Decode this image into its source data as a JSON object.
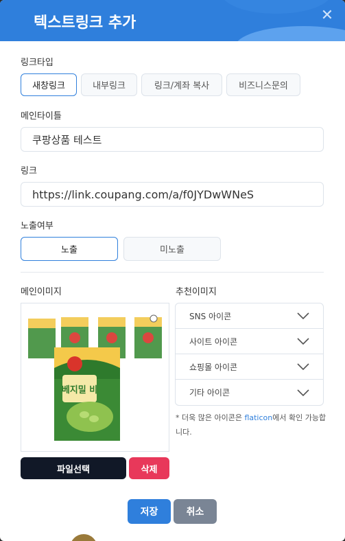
{
  "header": {
    "title": "텍스트링크 추가",
    "close_label": "✕"
  },
  "link_type": {
    "label": "링크타입",
    "tabs": [
      "새창링크",
      "내부링크",
      "링크/계좌 복사",
      "비즈니스문의"
    ],
    "active": "새창링크"
  },
  "main_title": {
    "label": "메인타이틀",
    "value": "쿠팡상품 테스트"
  },
  "link": {
    "label": "링크",
    "value": "https://link.coupang.com/a/f0JYDwWNeS"
  },
  "exposure": {
    "label": "노출여부",
    "options": [
      "노출",
      "미노출"
    ],
    "active": "노출"
  },
  "main_image": {
    "label": "메인이미지",
    "product_text": "베지밀 비"
  },
  "recommend": {
    "label": "추천이미지",
    "items": [
      "SNS 아이콘",
      "사이트 아이콘",
      "쇼핑몰 아이콘",
      "기타 아이콘"
    ]
  },
  "note": {
    "prefix": "* 더욱 많은 아이콘은 ",
    "link": "flaticon",
    "suffix": "에서 확인 가능합니다."
  },
  "buttons": {
    "file_select": "파일선택",
    "delete": "삭제",
    "save": "저장",
    "cancel": "취소"
  },
  "colors": {
    "primary": "#2f7fdc",
    "danger": "#e8385a",
    "dark": "#111827",
    "gray": "#7a8595"
  }
}
